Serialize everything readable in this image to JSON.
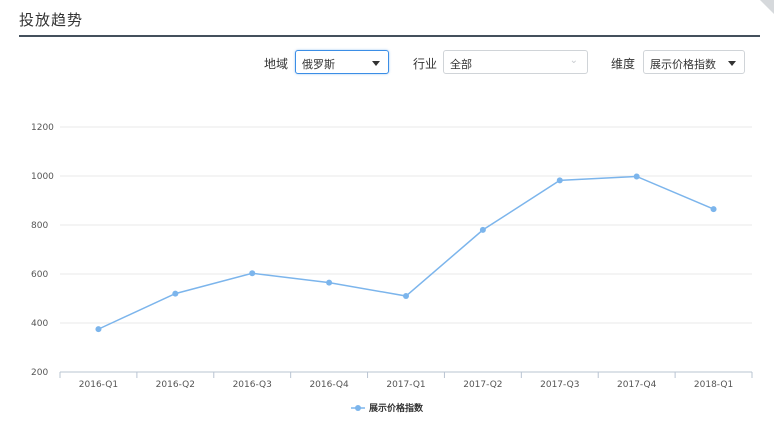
{
  "header": {
    "title": "投放趋势"
  },
  "filters": {
    "region": {
      "label": "地域",
      "value": "俄罗斯"
    },
    "industry": {
      "label": "行业",
      "value": "全部"
    },
    "dimension": {
      "label": "维度",
      "value": "展示价格指数"
    }
  },
  "colors": {
    "series": "#7cb5ec",
    "rule": "#44505c",
    "focus": "#3b8ee6"
  },
  "chart_data": {
    "type": "line",
    "categories": [
      "2016-Q1",
      "2016-Q2",
      "2016-Q3",
      "2016-Q4",
      "2017-Q1",
      "2017-Q2",
      "2017-Q3",
      "2017-Q4",
      "2018-Q1"
    ],
    "series": [
      {
        "name": "展示价格指数",
        "values": [
          375,
          520,
          603,
          565,
          510,
          780,
          982,
          998,
          865
        ]
      }
    ],
    "yticks": [
      200,
      400,
      600,
      800,
      1000,
      1200
    ],
    "ylim": [
      200,
      1200
    ],
    "grid": true,
    "legend": "bottom-center"
  }
}
